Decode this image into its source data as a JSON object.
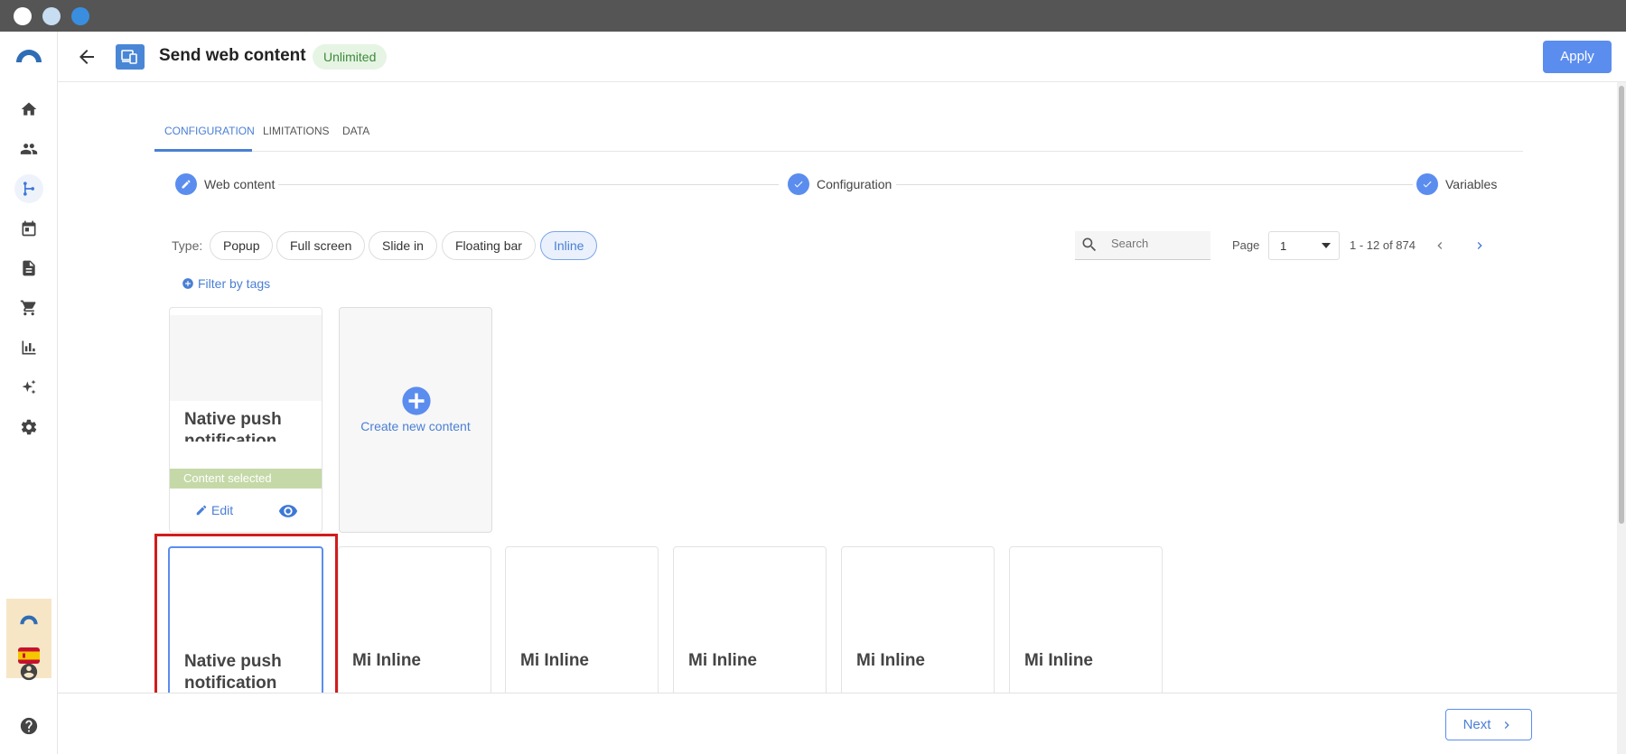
{
  "header": {
    "title": "Send web content",
    "badge": "Unlimited",
    "apply_label": "Apply"
  },
  "nav": {
    "items": [
      "home-icon",
      "people-icon",
      "journey-icon",
      "calendar-icon",
      "document-icon",
      "cart-icon",
      "chart-icon",
      "sparkle-icon",
      "gear-icon"
    ],
    "active_index": 2,
    "bottom": [
      "user-icon",
      "help-icon"
    ]
  },
  "tabs": [
    {
      "label": "CONFIGURATION",
      "active": true
    },
    {
      "label": "LIMITATIONS",
      "active": false
    },
    {
      "label": "DATA",
      "active": false
    }
  ],
  "stepper": [
    {
      "label": "Web content",
      "state": "edit"
    },
    {
      "label": "Configuration",
      "state": "done"
    },
    {
      "label": "Variables",
      "state": "done"
    }
  ],
  "filters": {
    "type_label": "Type:",
    "types": [
      "Popup",
      "Full screen",
      "Slide in",
      "Floating bar",
      "Inline"
    ],
    "active_type": "Inline",
    "filter_tags_label": "Filter by tags"
  },
  "search": {
    "placeholder": "Search"
  },
  "pagination": {
    "page_label": "Page",
    "page_value": "1",
    "range": "1 - 12 of 874"
  },
  "selected_card": {
    "title": "Native push notification",
    "status": "Content selected",
    "edit_label": "Edit"
  },
  "create_card": {
    "label": "Create new content"
  },
  "cards": [
    {
      "title": "Native push notification"
    },
    {
      "title": "Mi Inline"
    },
    {
      "title": "Mi Inline"
    },
    {
      "title": "Mi Inline"
    },
    {
      "title": "Mi Inline"
    },
    {
      "title": "Mi Inline"
    }
  ],
  "footer": {
    "next_label": "Next"
  },
  "colors": {
    "accent": "#5b8def",
    "highlight": "#d11c1c",
    "selected_bar": "#c5d9a8"
  }
}
